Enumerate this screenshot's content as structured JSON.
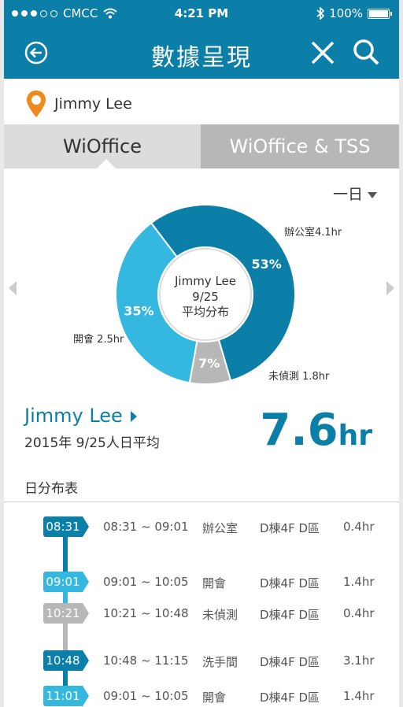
{
  "status": {
    "carrier": "CMCC",
    "time": "4:21 PM",
    "battery": "100%"
  },
  "nav": {
    "title": "數據呈現"
  },
  "user": {
    "name": "Jimmy Lee"
  },
  "tabs": [
    {
      "label": "WiOffice",
      "active": true
    },
    {
      "label": "WiOffice & TSS",
      "active": false
    }
  ],
  "period": {
    "label": "一日"
  },
  "chart_data": {
    "type": "pie",
    "center_text": [
      "Jimmy Lee",
      "9/25",
      "平均分布"
    ],
    "slices": [
      {
        "name": "辦公室4.1hr",
        "percent": 53,
        "label": "53%",
        "color": "#0b7fa7"
      },
      {
        "name": "未偵測 1.8hr",
        "percent": 7,
        "label": "7%",
        "color": "#b7b7b7"
      },
      {
        "name": "開會 2.5hr",
        "percent": 35,
        "label": "35%",
        "color": "#35b8df"
      }
    ]
  },
  "summary": {
    "name": "Jimmy Lee",
    "date": "2015年 9/25人日平均",
    "value": "7.6",
    "unit": "hr"
  },
  "schedule": {
    "title": "日分布表",
    "rows": [
      {
        "tag": "08:31",
        "color": "#0b7fa7",
        "range": "08:31 ~ 09:01",
        "activity": "辦公室",
        "location": "D棟4F  D區",
        "duration": "0.4hr"
      },
      {
        "tag": "09:01",
        "color": "#35b8df",
        "range": "09:01 ~ 10:05",
        "activity": "開會",
        "location": "D棟4F  D區",
        "duration": "1.4hr"
      },
      {
        "tag": "10:21",
        "color": "#b7b7b7",
        "range": "10:21 ~ 10:48",
        "activity": "未偵測",
        "location": "D棟4F  D區",
        "duration": "0.4hr"
      },
      {
        "tag": "10:48",
        "color": "#0b7fa7",
        "range": "10:48 ~ 11:15",
        "activity": "洗手間",
        "location": "D棟4F  D區",
        "duration": "3.1hr"
      },
      {
        "tag": "11:01",
        "color": "#35b8df",
        "range": "09:01 ~ 10:05",
        "activity": "開會",
        "location": "D棟4F  D區",
        "duration": "1.4hr"
      }
    ]
  }
}
